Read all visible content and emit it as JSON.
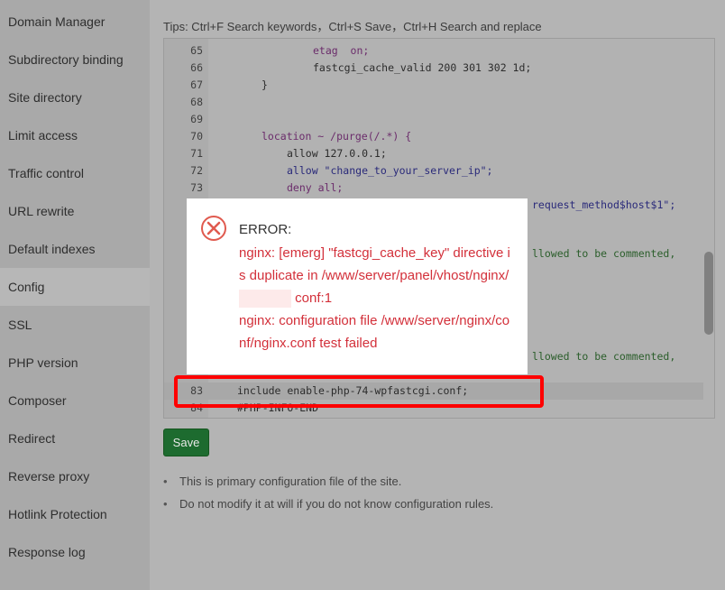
{
  "sidebar": {
    "items": [
      {
        "label": "Domain Manager"
      },
      {
        "label": "Subdirectory binding"
      },
      {
        "label": "Site directory"
      },
      {
        "label": "Limit access"
      },
      {
        "label": "Traffic control"
      },
      {
        "label": "URL rewrite"
      },
      {
        "label": "Default indexes"
      },
      {
        "label": "Config",
        "active": true
      },
      {
        "label": "SSL"
      },
      {
        "label": "PHP version"
      },
      {
        "label": "Composer"
      },
      {
        "label": "Redirect"
      },
      {
        "label": "Reverse proxy"
      },
      {
        "label": "Hotlink Protection"
      },
      {
        "label": "Response log"
      }
    ]
  },
  "tips": "Tips: Ctrl+F Search keywords，Ctrl+S Save，Ctrl+H Search and replace",
  "editor": {
    "lines": [
      {
        "num": "65",
        "code": "etag  on;"
      },
      {
        "num": "66",
        "code": "fastcgi_cache_valid 200 301 302 1d;"
      },
      {
        "num": "67",
        "code": "}"
      },
      {
        "num": "68",
        "code": ""
      },
      {
        "num": "69",
        "code": ""
      },
      {
        "num": "70",
        "code": "location ~ /purge(/.*) {"
      },
      {
        "num": "71",
        "code": "allow 127.0.0.1;"
      },
      {
        "num": "72",
        "code": "allow \"change_to_your_server_ip\";"
      },
      {
        "num": "73",
        "code": "deny all;"
      },
      {
        "num": "",
        "code": "request_method$host$1\";"
      },
      {
        "num": "",
        "code": "llowed to be commented,"
      },
      {
        "num": "",
        "code": "llowed to be commented,"
      },
      {
        "num": "83",
        "code": "include enable-php-74-wpfastcgi.conf;"
      },
      {
        "num": "84",
        "code": "#PHP-INFO-END"
      }
    ]
  },
  "modal": {
    "title": "ERROR:",
    "message_1": "nginx: [emerg] \"fastcgi_cache_key\" directive is duplicate in /www/server/panel/vhost/nginx/",
    "message_2": "conf:1",
    "message_3": "nginx: configuration file /www/server/nginx/conf/nginx.conf test failed",
    "icon": "error-circle-x-icon"
  },
  "save_label": "Save",
  "notes": [
    "This is primary configuration file of the site.",
    "Do not modify it at will if you do not know configuration rules."
  ],
  "colors": {
    "error": "#d3303a",
    "save": "#1d6b2f",
    "highlight": "#ff0000"
  }
}
